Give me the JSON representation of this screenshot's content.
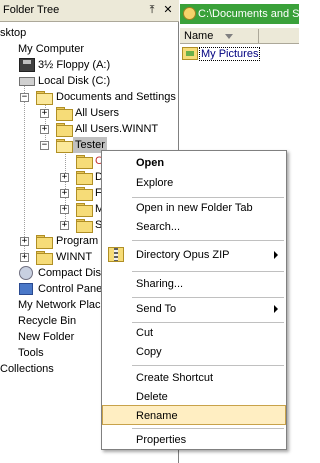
{
  "tree": {
    "title": "Folder Tree",
    "pin_glyph": "⤒",
    "close_glyph": "✕",
    "items": [
      {
        "label": "sktop"
      },
      {
        "label": "My Computer"
      },
      {
        "label": "3½ Floppy (A:)"
      },
      {
        "label": "Local Disk (C:)"
      },
      {
        "label": "Documents and Settings"
      },
      {
        "label": "All Users"
      },
      {
        "label": "All Users.WINNT"
      },
      {
        "label": "Tester"
      },
      {
        "label": "Program"
      },
      {
        "label": "WINNT"
      },
      {
        "label": "Compact Disc"
      },
      {
        "label": "Control Pane"
      },
      {
        "label": "My Network Place"
      },
      {
        "label": "Recycle Bin"
      },
      {
        "label": "New Folder"
      },
      {
        "label": "Tools"
      },
      {
        "label": "Collections"
      }
    ],
    "truncated_children": [
      "C",
      "D",
      "F",
      "M",
      "S"
    ]
  },
  "right": {
    "path": "C:\\Documents and Se",
    "column_name": "Name",
    "files": [
      {
        "label": "My Pictures"
      }
    ]
  },
  "context_menu": {
    "items": [
      {
        "label": "Open"
      },
      {
        "label": "Explore"
      },
      {
        "label": "Open in new Folder Tab"
      },
      {
        "label": "Search..."
      },
      {
        "label": "Directory Opus ZIP"
      },
      {
        "label": "Sharing..."
      },
      {
        "label": "Send To"
      },
      {
        "label": "Cut"
      },
      {
        "label": "Copy"
      },
      {
        "label": "Create Shortcut"
      },
      {
        "label": "Delete"
      },
      {
        "label": "Rename"
      },
      {
        "label": "Properties"
      }
    ],
    "highlighted": "Rename"
  },
  "colors": {
    "path_bar": "#3aa13a",
    "menu_highlight": "#ffeec2",
    "selection": "#c0c0c0"
  }
}
